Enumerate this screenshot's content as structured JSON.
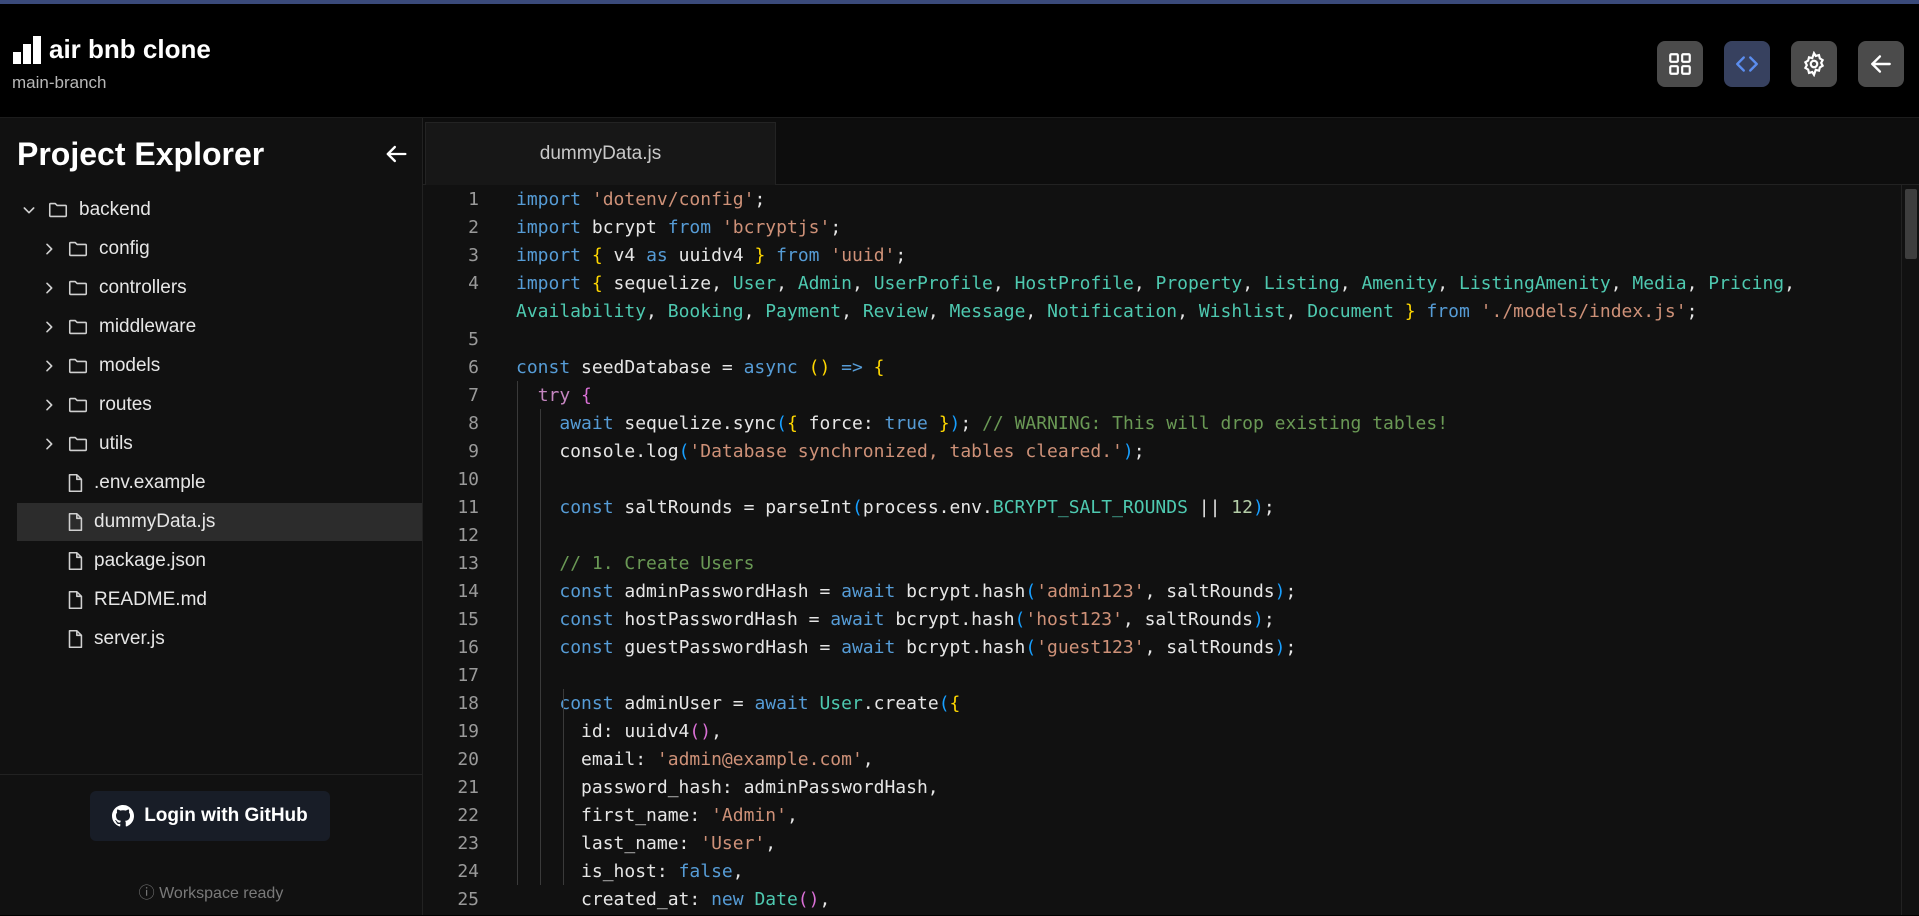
{
  "header": {
    "app_title": "air bnb clone",
    "branch": "main-branch",
    "buttons": [
      {
        "name": "grid-view-button",
        "icon": "grid-icon",
        "active": false
      },
      {
        "name": "code-view-button",
        "icon": "code-icon",
        "active": true
      },
      {
        "name": "settings-button",
        "icon": "gear-icon",
        "active": false
      },
      {
        "name": "back-button",
        "icon": "arrow-left-icon",
        "active": false
      }
    ]
  },
  "sidebar": {
    "title": "Project Explorer",
    "tree": [
      {
        "label": "backend",
        "type": "folder",
        "expanded": true,
        "depth": 0
      },
      {
        "label": "config",
        "type": "folder",
        "expanded": false,
        "depth": 1
      },
      {
        "label": "controllers",
        "type": "folder",
        "expanded": false,
        "depth": 1
      },
      {
        "label": "middleware",
        "type": "folder",
        "expanded": false,
        "depth": 1
      },
      {
        "label": "models",
        "type": "folder",
        "expanded": false,
        "depth": 1
      },
      {
        "label": "routes",
        "type": "folder",
        "expanded": false,
        "depth": 1
      },
      {
        "label": "utils",
        "type": "folder",
        "expanded": false,
        "depth": 1
      },
      {
        "label": ".env.example",
        "type": "file",
        "depth": 1
      },
      {
        "label": "dummyData.js",
        "type": "file",
        "depth": 1,
        "selected": true
      },
      {
        "label": "package.json",
        "type": "file",
        "depth": 1
      },
      {
        "label": "README.md",
        "type": "file",
        "depth": 1
      },
      {
        "label": "server.js",
        "type": "file",
        "depth": 1
      }
    ],
    "login_label": "Login with GitHub",
    "status": "ⓘ Workspace ready"
  },
  "editor": {
    "tab_label": "dummyData.js",
    "lines": [
      {
        "n": "1",
        "segs": [
          [
            "kw",
            "import"
          ],
          [
            "t",
            " "
          ],
          [
            "str",
            "'dotenv/config'"
          ],
          [
            "t",
            ";"
          ]
        ]
      },
      {
        "n": "2",
        "segs": [
          [
            "kw",
            "import"
          ],
          [
            "t",
            " bcrypt "
          ],
          [
            "kw",
            "from"
          ],
          [
            "t",
            " "
          ],
          [
            "str",
            "'bcryptjs'"
          ],
          [
            "t",
            ";"
          ]
        ]
      },
      {
        "n": "3",
        "segs": [
          [
            "kw",
            "import"
          ],
          [
            "t",
            " "
          ],
          [
            "br1",
            "{"
          ],
          [
            "t",
            " v4 "
          ],
          [
            "kw",
            "as"
          ],
          [
            "t",
            " uuidv4 "
          ],
          [
            "br1",
            "}"
          ],
          [
            "t",
            " "
          ],
          [
            "kw",
            "from"
          ],
          [
            "t",
            " "
          ],
          [
            "str",
            "'uuid'"
          ],
          [
            "t",
            ";"
          ]
        ]
      },
      {
        "n": "4",
        "segs": [
          [
            "kw",
            "import"
          ],
          [
            "t",
            " "
          ],
          [
            "br1",
            "{"
          ],
          [
            "t",
            " sequelize, "
          ],
          [
            "cls",
            "User"
          ],
          [
            "t",
            ", "
          ],
          [
            "cls",
            "Admin"
          ],
          [
            "t",
            ", "
          ],
          [
            "cls",
            "UserProfile"
          ],
          [
            "t",
            ", "
          ],
          [
            "cls",
            "HostProfile"
          ],
          [
            "t",
            ", "
          ],
          [
            "cls",
            "Property"
          ],
          [
            "t",
            ", "
          ],
          [
            "cls",
            "Listing"
          ],
          [
            "t",
            ", "
          ],
          [
            "cls",
            "Amenity"
          ],
          [
            "t",
            ", "
          ],
          [
            "cls",
            "ListingAmenity"
          ],
          [
            "t",
            ", "
          ],
          [
            "cls",
            "Media"
          ],
          [
            "t",
            ", "
          ],
          [
            "cls",
            "Pricing"
          ],
          [
            "t",
            ","
          ]
        ]
      },
      {
        "n": "",
        "segs": [
          [
            "cls",
            "Availability"
          ],
          [
            "t",
            ", "
          ],
          [
            "cls",
            "Booking"
          ],
          [
            "t",
            ", "
          ],
          [
            "cls",
            "Payment"
          ],
          [
            "t",
            ", "
          ],
          [
            "cls",
            "Review"
          ],
          [
            "t",
            ", "
          ],
          [
            "cls",
            "Message"
          ],
          [
            "t",
            ", "
          ],
          [
            "cls",
            "Notification"
          ],
          [
            "t",
            ", "
          ],
          [
            "cls",
            "Wishlist"
          ],
          [
            "t",
            ", "
          ],
          [
            "cls",
            "Document"
          ],
          [
            "t",
            " "
          ],
          [
            "br1",
            "}"
          ],
          [
            "t",
            " "
          ],
          [
            "kw",
            "from"
          ],
          [
            "t",
            " "
          ],
          [
            "str",
            "'./models/index.js'"
          ],
          [
            "t",
            ";"
          ]
        ]
      },
      {
        "n": "5",
        "segs": []
      },
      {
        "n": "6",
        "segs": [
          [
            "kw",
            "const"
          ],
          [
            "t",
            " seedDatabase = "
          ],
          [
            "kw",
            "async"
          ],
          [
            "t",
            " "
          ],
          [
            "br1",
            "()"
          ],
          [
            "t",
            " "
          ],
          [
            "kw",
            "=>"
          ],
          [
            "t",
            " "
          ],
          [
            "br1",
            "{"
          ]
        ]
      },
      {
        "n": "7",
        "segs": [
          [
            "t",
            "  "
          ],
          [
            "ctl",
            "try"
          ],
          [
            "t",
            " "
          ],
          [
            "br2",
            "{"
          ]
        ]
      },
      {
        "n": "8",
        "segs": [
          [
            "t",
            "    "
          ],
          [
            "kw",
            "await"
          ],
          [
            "t",
            " sequelize.sync"
          ],
          [
            "br3",
            "("
          ],
          [
            "br1",
            "{"
          ],
          [
            "t",
            " force: "
          ],
          [
            "kw",
            "true"
          ],
          [
            "t",
            " "
          ],
          [
            "br1",
            "}"
          ],
          [
            "br3",
            ")"
          ],
          [
            "t",
            "; "
          ],
          [
            "com",
            "// WARNING: This will drop existing tables!"
          ]
        ]
      },
      {
        "n": "9",
        "segs": [
          [
            "t",
            "    console.log"
          ],
          [
            "br3",
            "("
          ],
          [
            "str",
            "'Database synchronized, tables cleared.'"
          ],
          [
            "br3",
            ")"
          ],
          [
            "t",
            ";"
          ]
        ]
      },
      {
        "n": "10",
        "segs": []
      },
      {
        "n": "11",
        "segs": [
          [
            "t",
            "    "
          ],
          [
            "kw",
            "const"
          ],
          [
            "t",
            " saltRounds = parseInt"
          ],
          [
            "br3",
            "("
          ],
          [
            "t",
            "process.env."
          ],
          [
            "cls",
            "BCRYPT_SALT_ROUNDS"
          ],
          [
            "t",
            " || "
          ],
          [
            "num",
            "12"
          ],
          [
            "br3",
            ")"
          ],
          [
            "t",
            ";"
          ]
        ]
      },
      {
        "n": "12",
        "segs": []
      },
      {
        "n": "13",
        "segs": [
          [
            "t",
            "    "
          ],
          [
            "com",
            "// 1. Create Users"
          ]
        ]
      },
      {
        "n": "14",
        "segs": [
          [
            "t",
            "    "
          ],
          [
            "kw",
            "const"
          ],
          [
            "t",
            " adminPasswordHash = "
          ],
          [
            "kw",
            "await"
          ],
          [
            "t",
            " bcrypt.hash"
          ],
          [
            "br3",
            "("
          ],
          [
            "str",
            "'admin123'"
          ],
          [
            "t",
            ", saltRounds"
          ],
          [
            "br3",
            ")"
          ],
          [
            "t",
            ";"
          ]
        ]
      },
      {
        "n": "15",
        "segs": [
          [
            "t",
            "    "
          ],
          [
            "kw",
            "const"
          ],
          [
            "t",
            " hostPasswordHash = "
          ],
          [
            "kw",
            "await"
          ],
          [
            "t",
            " bcrypt.hash"
          ],
          [
            "br3",
            "("
          ],
          [
            "str",
            "'host123'"
          ],
          [
            "t",
            ", saltRounds"
          ],
          [
            "br3",
            ")"
          ],
          [
            "t",
            ";"
          ]
        ]
      },
      {
        "n": "16",
        "segs": [
          [
            "t",
            "    "
          ],
          [
            "kw",
            "const"
          ],
          [
            "t",
            " guestPasswordHash = "
          ],
          [
            "kw",
            "await"
          ],
          [
            "t",
            " bcrypt.hash"
          ],
          [
            "br3",
            "("
          ],
          [
            "str",
            "'guest123'"
          ],
          [
            "t",
            ", saltRounds"
          ],
          [
            "br3",
            ")"
          ],
          [
            "t",
            ";"
          ]
        ]
      },
      {
        "n": "17",
        "segs": []
      },
      {
        "n": "18",
        "segs": [
          [
            "t",
            "    "
          ],
          [
            "kw",
            "const"
          ],
          [
            "t",
            " adminUser = "
          ],
          [
            "kw",
            "await"
          ],
          [
            "t",
            " "
          ],
          [
            "cls",
            "User"
          ],
          [
            "t",
            ".create"
          ],
          [
            "br3",
            "("
          ],
          [
            "br1",
            "{"
          ]
        ]
      },
      {
        "n": "19",
        "segs": [
          [
            "t",
            "      id: uuidv4"
          ],
          [
            "br2",
            "()"
          ],
          [
            "t",
            ","
          ]
        ]
      },
      {
        "n": "20",
        "segs": [
          [
            "t",
            "      email: "
          ],
          [
            "str",
            "'admin@example.com'"
          ],
          [
            "t",
            ","
          ]
        ]
      },
      {
        "n": "21",
        "segs": [
          [
            "t",
            "      password_hash: adminPasswordHash,"
          ]
        ]
      },
      {
        "n": "22",
        "segs": [
          [
            "t",
            "      first_name: "
          ],
          [
            "str",
            "'Admin'"
          ],
          [
            "t",
            ","
          ]
        ]
      },
      {
        "n": "23",
        "segs": [
          [
            "t",
            "      last_name: "
          ],
          [
            "str",
            "'User'"
          ],
          [
            "t",
            ","
          ]
        ]
      },
      {
        "n": "24",
        "segs": [
          [
            "t",
            "      is_host: "
          ],
          [
            "kw",
            "false"
          ],
          [
            "t",
            ","
          ]
        ]
      },
      {
        "n": "25",
        "segs": [
          [
            "t",
            "      created_at: "
          ],
          [
            "kw",
            "new"
          ],
          [
            "t",
            " "
          ],
          [
            "cls",
            "Date"
          ],
          [
            "br2",
            "()"
          ],
          [
            "t",
            ","
          ]
        ]
      }
    ]
  }
}
